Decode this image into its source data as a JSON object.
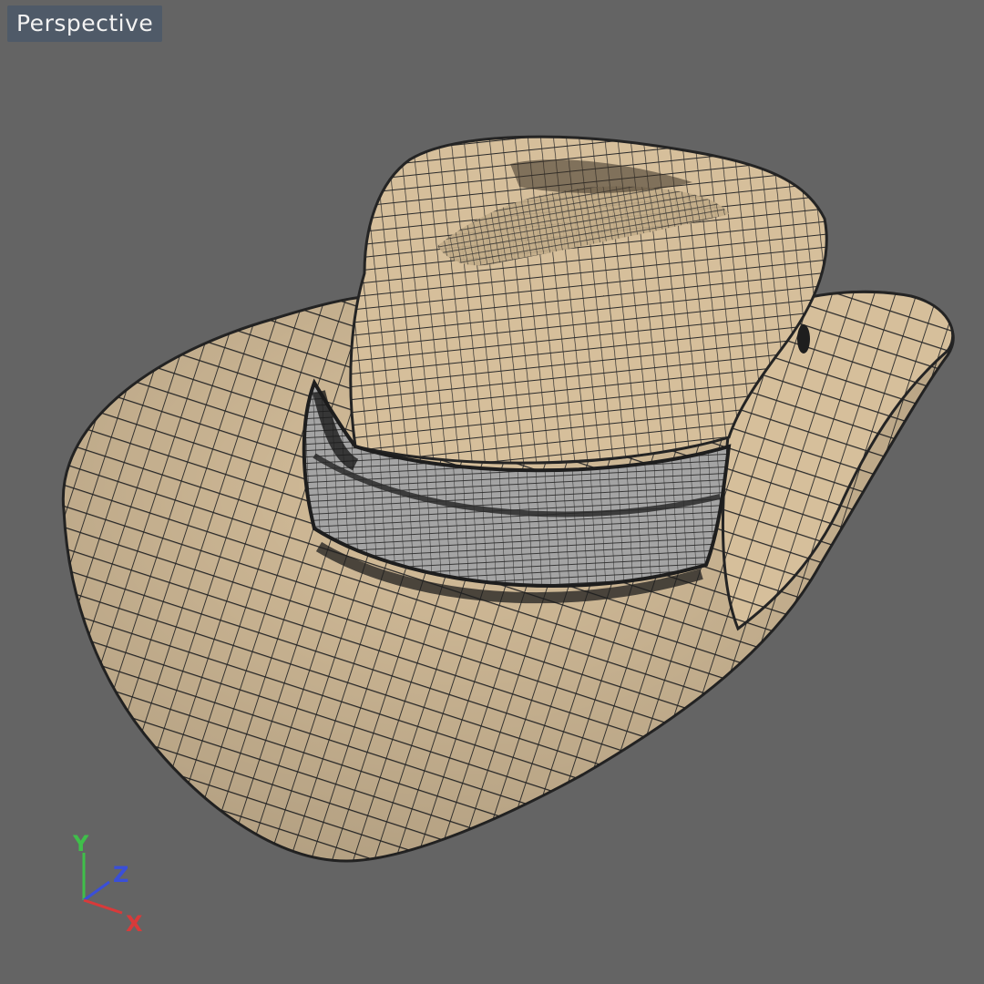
{
  "viewport": {
    "label": "Perspective",
    "background": "#646464",
    "label_background": "#4f5a68"
  },
  "model": {
    "object": "hat-mesh",
    "display_mode": "shaded-wireframe",
    "surface_color": "#d6bf9b",
    "band_color": "#9a9a9a",
    "wire_color": "#2a2a2a"
  },
  "axes": {
    "x_label": "X",
    "y_label": "Y",
    "z_label": "Z",
    "x_color": "#d83a3a",
    "y_color": "#3fbf4a",
    "z_color": "#3a4fd8"
  }
}
